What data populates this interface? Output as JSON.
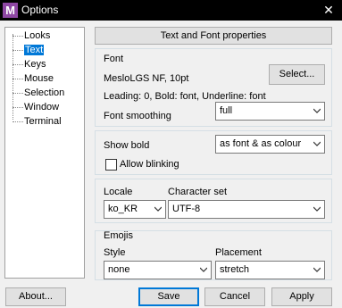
{
  "window": {
    "title": "Options",
    "icon_letter": "M",
    "close_glyph": "✕"
  },
  "tree": {
    "items": [
      {
        "label": "Looks",
        "selected": false
      },
      {
        "label": "Text",
        "selected": true
      },
      {
        "label": "Keys",
        "selected": false
      },
      {
        "label": "Mouse",
        "selected": false
      },
      {
        "label": "Selection",
        "selected": false
      },
      {
        "label": "Window",
        "selected": false
      },
      {
        "label": "Terminal",
        "selected": false
      }
    ]
  },
  "header": {
    "title": "Text and Font properties"
  },
  "font": {
    "group_label": "Font",
    "current": "MesloLGS NF, 10pt",
    "select_button": "Select...",
    "details": "Leading: 0, Bold: font, Underline: font",
    "smoothing_label": "Font smoothing",
    "smoothing_value": "full"
  },
  "bold": {
    "show_bold_label": "Show bold",
    "show_bold_value": "as font & as colour",
    "allow_blinking_label": "Allow blinking",
    "allow_blinking_checked": false
  },
  "locale": {
    "locale_label": "Locale",
    "locale_value": "ko_KR",
    "charset_label": "Character set",
    "charset_value": "UTF-8"
  },
  "emojis": {
    "group_label": "Emojis",
    "style_label": "Style",
    "style_value": "none",
    "placement_label": "Placement",
    "placement_value": "stretch"
  },
  "footer": {
    "about": "About...",
    "save": "Save",
    "cancel": "Cancel",
    "apply": "Apply"
  },
  "colors": {
    "accent": "#0078d7",
    "app_icon": "#8e47a3"
  }
}
